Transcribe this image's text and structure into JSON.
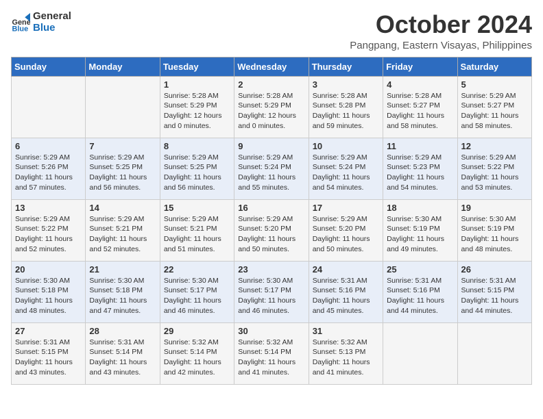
{
  "logo": {
    "line1": "General",
    "line2": "Blue"
  },
  "title": "October 2024",
  "subtitle": "Pangpang, Eastern Visayas, Philippines",
  "weekdays": [
    "Sunday",
    "Monday",
    "Tuesday",
    "Wednesday",
    "Thursday",
    "Friday",
    "Saturday"
  ],
  "weeks": [
    [
      {
        "day": "",
        "info": ""
      },
      {
        "day": "",
        "info": ""
      },
      {
        "day": "1",
        "info": "Sunrise: 5:28 AM\nSunset: 5:29 PM\nDaylight: 12 hours\nand 0 minutes."
      },
      {
        "day": "2",
        "info": "Sunrise: 5:28 AM\nSunset: 5:29 PM\nDaylight: 12 hours\nand 0 minutes."
      },
      {
        "day": "3",
        "info": "Sunrise: 5:28 AM\nSunset: 5:28 PM\nDaylight: 11 hours\nand 59 minutes."
      },
      {
        "day": "4",
        "info": "Sunrise: 5:28 AM\nSunset: 5:27 PM\nDaylight: 11 hours\nand 58 minutes."
      },
      {
        "day": "5",
        "info": "Sunrise: 5:29 AM\nSunset: 5:27 PM\nDaylight: 11 hours\nand 58 minutes."
      }
    ],
    [
      {
        "day": "6",
        "info": "Sunrise: 5:29 AM\nSunset: 5:26 PM\nDaylight: 11 hours\nand 57 minutes."
      },
      {
        "day": "7",
        "info": "Sunrise: 5:29 AM\nSunset: 5:25 PM\nDaylight: 11 hours\nand 56 minutes."
      },
      {
        "day": "8",
        "info": "Sunrise: 5:29 AM\nSunset: 5:25 PM\nDaylight: 11 hours\nand 56 minutes."
      },
      {
        "day": "9",
        "info": "Sunrise: 5:29 AM\nSunset: 5:24 PM\nDaylight: 11 hours\nand 55 minutes."
      },
      {
        "day": "10",
        "info": "Sunrise: 5:29 AM\nSunset: 5:24 PM\nDaylight: 11 hours\nand 54 minutes."
      },
      {
        "day": "11",
        "info": "Sunrise: 5:29 AM\nSunset: 5:23 PM\nDaylight: 11 hours\nand 54 minutes."
      },
      {
        "day": "12",
        "info": "Sunrise: 5:29 AM\nSunset: 5:22 PM\nDaylight: 11 hours\nand 53 minutes."
      }
    ],
    [
      {
        "day": "13",
        "info": "Sunrise: 5:29 AM\nSunset: 5:22 PM\nDaylight: 11 hours\nand 52 minutes."
      },
      {
        "day": "14",
        "info": "Sunrise: 5:29 AM\nSunset: 5:21 PM\nDaylight: 11 hours\nand 52 minutes."
      },
      {
        "day": "15",
        "info": "Sunrise: 5:29 AM\nSunset: 5:21 PM\nDaylight: 11 hours\nand 51 minutes."
      },
      {
        "day": "16",
        "info": "Sunrise: 5:29 AM\nSunset: 5:20 PM\nDaylight: 11 hours\nand 50 minutes."
      },
      {
        "day": "17",
        "info": "Sunrise: 5:29 AM\nSunset: 5:20 PM\nDaylight: 11 hours\nand 50 minutes."
      },
      {
        "day": "18",
        "info": "Sunrise: 5:30 AM\nSunset: 5:19 PM\nDaylight: 11 hours\nand 49 minutes."
      },
      {
        "day": "19",
        "info": "Sunrise: 5:30 AM\nSunset: 5:19 PM\nDaylight: 11 hours\nand 48 minutes."
      }
    ],
    [
      {
        "day": "20",
        "info": "Sunrise: 5:30 AM\nSunset: 5:18 PM\nDaylight: 11 hours\nand 48 minutes."
      },
      {
        "day": "21",
        "info": "Sunrise: 5:30 AM\nSunset: 5:18 PM\nDaylight: 11 hours\nand 47 minutes."
      },
      {
        "day": "22",
        "info": "Sunrise: 5:30 AM\nSunset: 5:17 PM\nDaylight: 11 hours\nand 46 minutes."
      },
      {
        "day": "23",
        "info": "Sunrise: 5:30 AM\nSunset: 5:17 PM\nDaylight: 11 hours\nand 46 minutes."
      },
      {
        "day": "24",
        "info": "Sunrise: 5:31 AM\nSunset: 5:16 PM\nDaylight: 11 hours\nand 45 minutes."
      },
      {
        "day": "25",
        "info": "Sunrise: 5:31 AM\nSunset: 5:16 PM\nDaylight: 11 hours\nand 44 minutes."
      },
      {
        "day": "26",
        "info": "Sunrise: 5:31 AM\nSunset: 5:15 PM\nDaylight: 11 hours\nand 44 minutes."
      }
    ],
    [
      {
        "day": "27",
        "info": "Sunrise: 5:31 AM\nSunset: 5:15 PM\nDaylight: 11 hours\nand 43 minutes."
      },
      {
        "day": "28",
        "info": "Sunrise: 5:31 AM\nSunset: 5:14 PM\nDaylight: 11 hours\nand 43 minutes."
      },
      {
        "day": "29",
        "info": "Sunrise: 5:32 AM\nSunset: 5:14 PM\nDaylight: 11 hours\nand 42 minutes."
      },
      {
        "day": "30",
        "info": "Sunrise: 5:32 AM\nSunset: 5:14 PM\nDaylight: 11 hours\nand 41 minutes."
      },
      {
        "day": "31",
        "info": "Sunrise: 5:32 AM\nSunset: 5:13 PM\nDaylight: 11 hours\nand 41 minutes."
      },
      {
        "day": "",
        "info": ""
      },
      {
        "day": "",
        "info": ""
      }
    ]
  ]
}
